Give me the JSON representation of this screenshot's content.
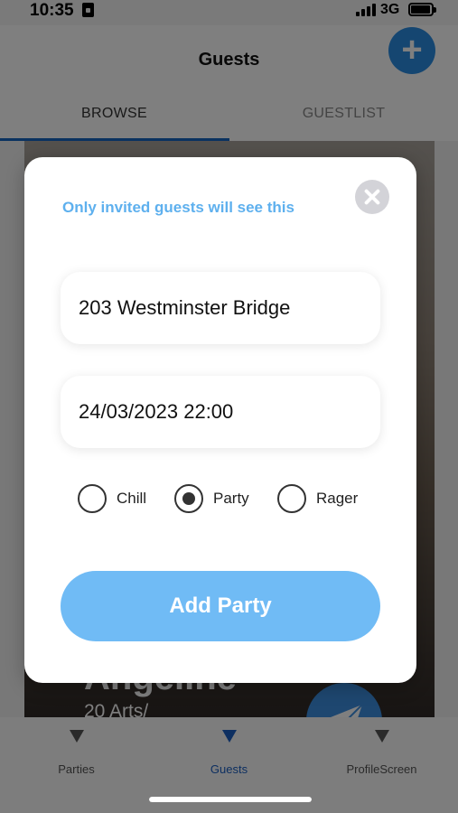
{
  "status_bar": {
    "time": "10:35",
    "network": "3G"
  },
  "header": {
    "title": "Guests"
  },
  "tabs": [
    {
      "label": "BROWSE"
    },
    {
      "label": "GUESTLIST"
    }
  ],
  "card": {
    "name": "Angeline",
    "subtitle": "20 Arts/"
  },
  "modal": {
    "note": "Only invited guests will see this",
    "address_value": "203 Westminster Bridge",
    "datetime_value": "24/03/2023 22:00",
    "options": [
      {
        "label": "Chill",
        "selected": false
      },
      {
        "label": "Party",
        "selected": true
      },
      {
        "label": "Rager",
        "selected": false
      }
    ],
    "submit_label": "Add Party"
  },
  "bottom_nav": [
    {
      "label": "Parties"
    },
    {
      "label": "Guests"
    },
    {
      "label": "ProfileScreen"
    }
  ],
  "colors": {
    "accent": "#5eb0ee",
    "button": "#70bbf5",
    "nav_active": "#1a5fc2"
  }
}
